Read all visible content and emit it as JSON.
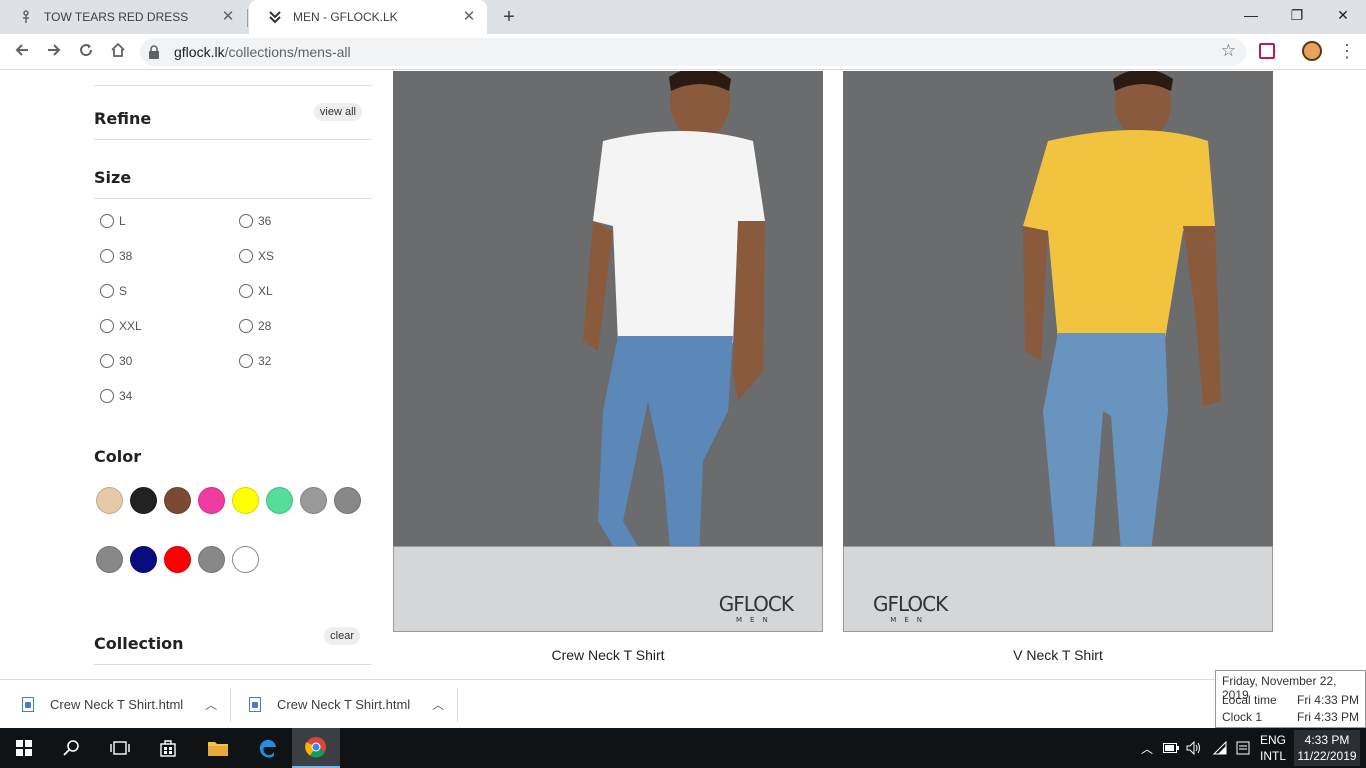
{
  "browser": {
    "tabs": [
      {
        "title": "TOW TEARS RED DRESS",
        "close": "✕"
      },
      {
        "title": "MEN - GFLOCK.LK",
        "close": "✕"
      }
    ],
    "new_tab": "+",
    "window_controls": {
      "minimize": "—",
      "maximize": "❐",
      "close": "✕"
    },
    "url_host": "gflock.lk",
    "url_path": "/collections/mens-all",
    "icons": [
      "back-icon",
      "forward-icon",
      "reload-icon",
      "home-icon",
      "lock-icon",
      "star-icon",
      "extension-icon",
      "profile-avatar",
      "menu-icon"
    ]
  },
  "sidebar": {
    "refine_title": "Refine",
    "refine_action": "view all",
    "size_title": "Size",
    "sizes": [
      "L",
      "36",
      "38",
      "XS",
      "S",
      "XL",
      "XXL",
      "28",
      "30",
      "32",
      "34"
    ],
    "color_title": "Color",
    "colors": [
      "#e5c9a8",
      "#222222",
      "#7a4a34",
      "#f03ca0",
      "#ffff00",
      "#55dd99",
      "#999999",
      "#888888",
      "#888888",
      "#0b0b80",
      "#ff0000",
      "#888888",
      "#ffffff"
    ],
    "collection_title": "Collection",
    "collection_action": "clear"
  },
  "products": [
    {
      "name": "Crew Neck T Shirt",
      "brand": "GFLOCK",
      "brand_sub": "MEN",
      "shirt_color": "#f4f4f4"
    },
    {
      "name": "V Neck T Shirt",
      "brand": "GFLOCK",
      "brand_sub": "MEN",
      "shirt_color": "#f2c33f"
    }
  ],
  "downloads": [
    {
      "name": "Crew Neck T Shirt.html"
    },
    {
      "name": "Crew Neck T Shirt.html"
    }
  ],
  "clock_popup": {
    "date": "Friday, November 22, 2019",
    "local_label": "Local time",
    "local_value": "Fri 4:33 PM",
    "clock1_label": "Clock 1",
    "clock1_value": "Fri 4:33 PM"
  },
  "taskbar": {
    "lang_top": "ENG",
    "lang_bottom": "INTL",
    "time": "4:33 PM",
    "date": "11/22/2019"
  }
}
